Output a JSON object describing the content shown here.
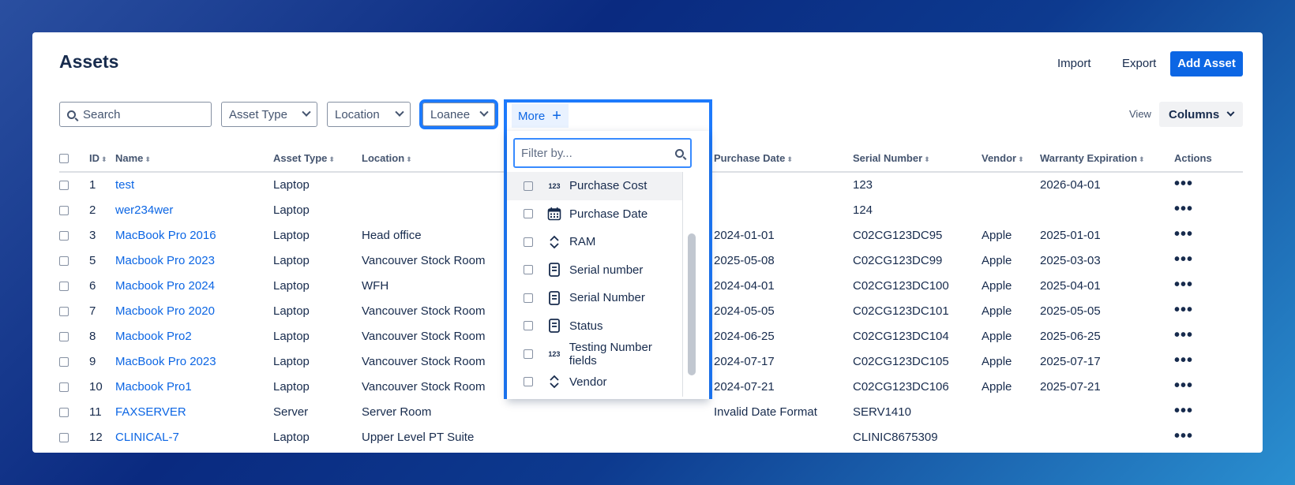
{
  "header": {
    "title": "Assets",
    "import_label": "Import",
    "export_label": "Export",
    "add_label": "Add Asset"
  },
  "filters": {
    "search_placeholder": "Search",
    "asset_type": "Asset Type",
    "location": "Location",
    "loanee": "Loanee",
    "more": "More",
    "view_label": "View",
    "columns_label": "Columns"
  },
  "table": {
    "columns": [
      "ID",
      "Name",
      "Asset Type",
      "Location",
      "Purchase Date",
      "Serial Number",
      "Vendor",
      "Warranty Expiration",
      "Actions"
    ],
    "rows": [
      {
        "id": "1",
        "name": "test",
        "type": "Laptop",
        "location": "",
        "purchase": "",
        "serial": "123",
        "vendor": "",
        "warranty": "2026-04-01"
      },
      {
        "id": "2",
        "name": "wer234wer",
        "type": "Laptop",
        "location": "",
        "purchase": "",
        "serial": "124",
        "vendor": "",
        "warranty": ""
      },
      {
        "id": "3",
        "name": "MacBook Pro 2016",
        "type": "Laptop",
        "location": "Head office",
        "purchase": "2024-01-01",
        "serial": "C02CG123DC95",
        "vendor": "Apple",
        "warranty": "2025-01-01"
      },
      {
        "id": "5",
        "name": "Macbook Pro 2023",
        "type": "Laptop",
        "location": "Vancouver Stock Room",
        "purchase": "2025-05-08",
        "serial": "C02CG123DC99",
        "vendor": "Apple",
        "warranty": "2025-03-03"
      },
      {
        "id": "6",
        "name": "Macbook Pro 2024",
        "type": "Laptop",
        "location": "WFH",
        "purchase": "2024-04-01",
        "serial": "C02CG123DC100",
        "vendor": "Apple",
        "warranty": "2025-04-01"
      },
      {
        "id": "7",
        "name": "Macbook Pro 2020",
        "type": "Laptop",
        "location": "Vancouver Stock Room",
        "purchase": "2024-05-05",
        "serial": "C02CG123DC101",
        "vendor": "Apple",
        "warranty": "2025-05-05"
      },
      {
        "id": "8",
        "name": "Macbook Pro2",
        "type": "Laptop",
        "location": "Vancouver Stock Room",
        "purchase": "2024-06-25",
        "serial": "C02CG123DC104",
        "vendor": "Apple",
        "warranty": "2025-06-25"
      },
      {
        "id": "9",
        "name": "MacBook Pro 2023",
        "type": "Laptop",
        "location": "Vancouver Stock Room",
        "purchase": "2024-07-17",
        "serial": "C02CG123DC105",
        "vendor": "Apple",
        "warranty": "2025-07-17"
      },
      {
        "id": "10",
        "name": "Macbook Pro1",
        "type": "Laptop",
        "location": "Vancouver Stock Room",
        "purchase": "2024-07-21",
        "serial": "C02CG123DC106",
        "vendor": "Apple",
        "warranty": "2025-07-21"
      },
      {
        "id": "11",
        "name": "FAXSERVER",
        "type": "Server",
        "location": "Server Room",
        "purchase": "Invalid Date Format",
        "serial": "SERV1410",
        "vendor": "",
        "warranty": ""
      },
      {
        "id": "12",
        "name": "CLINICAL-7",
        "type": "Laptop",
        "location": "Upper Level PT Suite",
        "purchase": "",
        "serial": "CLINIC8675309",
        "vendor": "",
        "warranty": ""
      }
    ],
    "actions_glyph": "•••"
  },
  "dropdown": {
    "filter_placeholder": "Filter by...",
    "number_glyph": "123",
    "items": [
      {
        "label": "Purchase Cost",
        "icon": "number-icon"
      },
      {
        "label": "Purchase Date",
        "icon": "calendar-icon"
      },
      {
        "label": "RAM",
        "icon": "select-icon"
      },
      {
        "label": "Serial number",
        "icon": "document-icon"
      },
      {
        "label": "Serial Number",
        "icon": "document-icon"
      },
      {
        "label": "Status",
        "icon": "document-icon"
      },
      {
        "label": "Testing Number fields",
        "icon": "number-icon"
      },
      {
        "label": "Vendor",
        "icon": "select-icon"
      }
    ]
  },
  "colors": {
    "accent": "#0c66e4",
    "highlight": "#1d7afc"
  }
}
